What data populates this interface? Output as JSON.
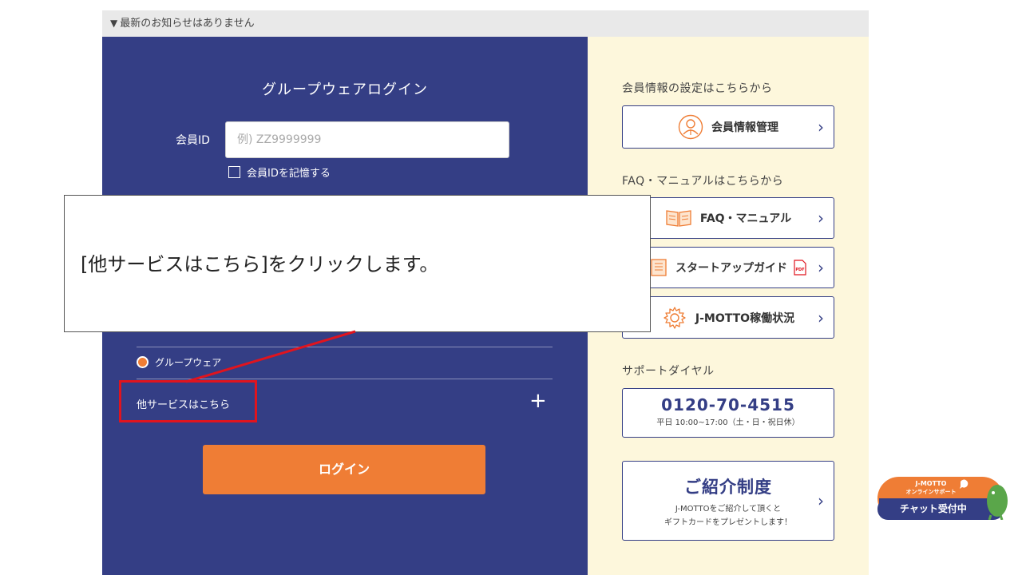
{
  "notice": {
    "arrow": "▼",
    "text": "最新のお知らせはありません"
  },
  "login": {
    "title": "グループウェアログイン",
    "id_label": "会員ID",
    "id_placeholder": "例) ZZ9999999",
    "id_value": "",
    "remember_label": "会員IDを記憶する",
    "groupware_label": "グループウェア",
    "other_services_label": "他サービスはこちら",
    "expand_symbol": "+",
    "button_label": "ログイン"
  },
  "side": {
    "member_heading": "会員情報の設定はこちらから",
    "member_button": "会員情報管理",
    "faq_heading": "FAQ・マニュアルはこちらから",
    "faq_button": "FAQ・マニュアル",
    "startup_button": "スタートアップガイド",
    "status_button": "J-MOTTO稼働状況",
    "support_heading": "サポートダイヤル",
    "support_number": "0120-70-4515",
    "support_hours": "平日 10:00~17:00（土・日・祝日休）",
    "referral_title": "ご紹介制度",
    "referral_desc": "J-MOTTOをご紹介して頂くと\nギフトカードをプレゼントします！",
    "chevron": "›"
  },
  "callout": {
    "text": "[他サービスはこちら]をクリックします。"
  },
  "chat": {
    "brand": "J-MOTTO",
    "sub": "オンラインサポート",
    "status": "チャット受付中"
  },
  "colors": {
    "navy": "#343e85",
    "orange": "#ef7d35",
    "cream": "#fdf7dc",
    "red": "#e0141e"
  }
}
